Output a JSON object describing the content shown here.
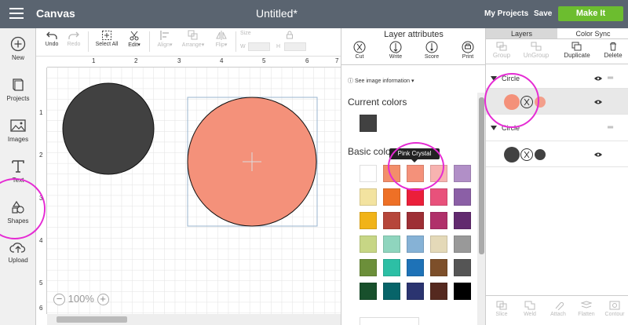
{
  "topbar": {
    "app_title": "Canvas",
    "doc_title": "Untitled*",
    "my_projects": "My Projects",
    "save": "Save",
    "make_it": "Make It"
  },
  "leftbar": {
    "items": [
      {
        "label": "New",
        "icon": "plus-circle-icon"
      },
      {
        "label": "Projects",
        "icon": "book-icon"
      },
      {
        "label": "Images",
        "icon": "image-icon"
      },
      {
        "label": "Text",
        "icon": "text-t-icon"
      },
      {
        "label": "Shapes",
        "icon": "shapes-icon"
      },
      {
        "label": "Upload",
        "icon": "upload-cloud-icon"
      }
    ]
  },
  "toolbar": {
    "undo": "Undo",
    "redo": "Redo",
    "select_all": "Select All",
    "edit": "Edit",
    "align": "Align",
    "arrange": "Arrange",
    "flip": "Flip",
    "size": "Size",
    "w": "W",
    "h": "H"
  },
  "rulers": {
    "top": [
      "1",
      "2",
      "3",
      "4",
      "5",
      "6",
      "7"
    ],
    "left": [
      "1",
      "2",
      "3",
      "4",
      "5",
      "6"
    ]
  },
  "zoom": {
    "value": "100%",
    "minus": "−",
    "plus": "+"
  },
  "layer_attributes": {
    "title": "Layer attributes",
    "tabs": [
      "Cut",
      "Write",
      "Score",
      "Print"
    ],
    "see_info": "See image information",
    "current_colors": "Current colors",
    "basic_colors": "Basic colors",
    "tooltip": "Pink Crystal",
    "current_color_value": "#414141",
    "swatches": [
      [
        "#ffffff",
        "#f38e6a",
        "#f4917a",
        "#f7b3b0",
        "#b18fc7"
      ],
      [
        "#f3e3a0",
        "#ee7026",
        "#eb1f3a",
        "#e8517b",
        "#8b5fa6"
      ],
      [
        "#f1b318",
        "#b6463a",
        "#9e2f35",
        "#b0306a",
        "#622a6f"
      ],
      [
        "#c7d685",
        "#8fd5be",
        "#86b2d6",
        "#e4d9b8",
        "#999999"
      ],
      [
        "#6c8f3a",
        "#2dbfa5",
        "#1e72b7",
        "#7d4f2a",
        "#555555"
      ],
      [
        "#18502c",
        "#076469",
        "#2b3470",
        "#55291f",
        "#000000"
      ]
    ]
  },
  "layers_panel": {
    "tabs": [
      "Layers",
      "Color Sync"
    ],
    "tools": [
      "Group",
      "UnGroup",
      "Duplicate",
      "Delete"
    ],
    "groups": [
      {
        "name": "Circle",
        "color": "#f4917a"
      },
      {
        "name": "Circle",
        "color": "#414141"
      }
    ],
    "bottom_tools": [
      "Slice",
      "Weld",
      "Attach",
      "Flatten",
      "Contour"
    ]
  },
  "colors": {
    "accent_green": "#6cbd2f",
    "topbar": "#5a6470",
    "highlight_magenta": "#e52bd3",
    "circle_dark": "#414141",
    "circle_pink": "#f4917a"
  }
}
